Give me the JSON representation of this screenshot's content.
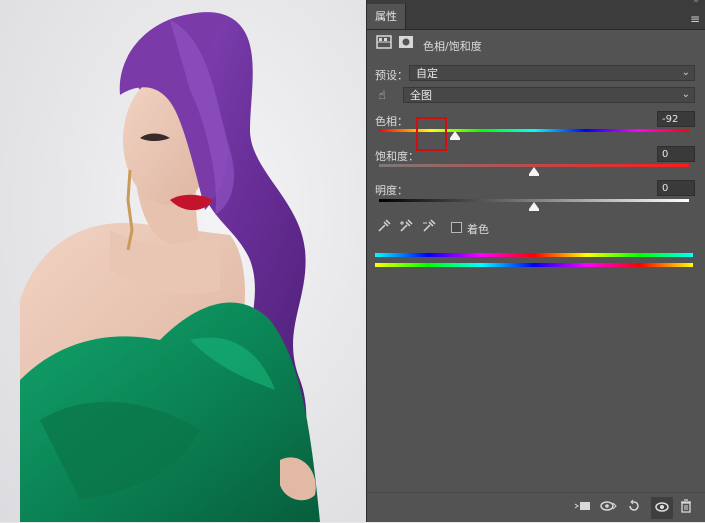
{
  "panel": {
    "tab_label": "属性",
    "header_title": "色相/饱和度",
    "preset_label": "预设：",
    "preset_value": "自定",
    "channel_value": "全图",
    "hue": {
      "label": "色相：",
      "value": "-92",
      "level": -92,
      "min": -180,
      "max": 180
    },
    "saturation": {
      "label": "饱和度：",
      "value": "0",
      "level": 0,
      "min": -100,
      "max": 100
    },
    "lightness": {
      "label": "明度：",
      "value": "0",
      "level": 0,
      "min": -100,
      "max": 100
    },
    "colorize_label": "着色",
    "colorize_checked": false
  },
  "icons": {
    "adjustment": "hue-saturation-layer-icon",
    "mask": "mask-icon",
    "hand": "targeted-adjustment-hand-icon",
    "eyedropper": "eyedropper-icon",
    "eyedropper_plus": "eyedropper-add-icon",
    "eyedropper_minus": "eyedropper-subtract-icon",
    "clip": "clip-to-layer-icon",
    "view_previous": "view-previous-icon",
    "reset": "reset-icon",
    "visibility": "eye-icon",
    "delete": "trash-icon"
  },
  "colors": {
    "panel_bg": "#535353",
    "highlight": "#d01010",
    "dress": "#0e8a5a",
    "hair": "#7b3fa8"
  }
}
